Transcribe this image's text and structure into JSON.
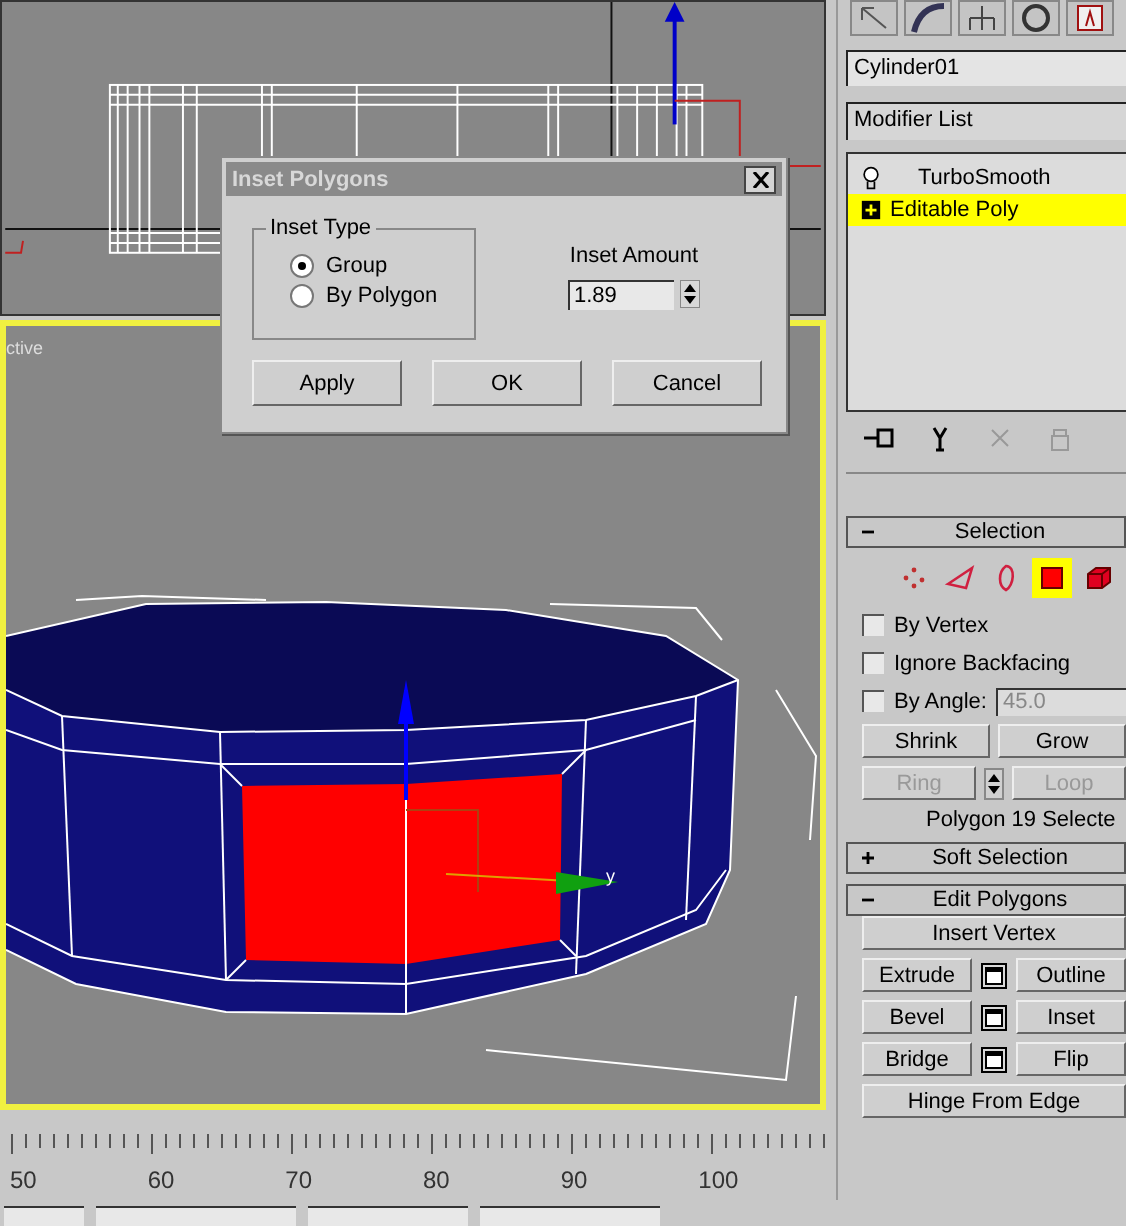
{
  "viewports": [
    {
      "kind": "front",
      "active": false
    },
    {
      "kind": "perspective",
      "label": "ctive",
      "active": true,
      "axis_label": "y"
    }
  ],
  "dialog": {
    "title": "Inset Polygons",
    "group_label": "Inset Type",
    "options": [
      {
        "label": "Group",
        "selected": true
      },
      {
        "label": "By Polygon",
        "selected": false
      }
    ],
    "amount_label": "Inset Amount",
    "amount_value": "1.89",
    "buttons": [
      "Apply",
      "OK",
      "Cancel"
    ]
  },
  "command_panel": {
    "object_name": "Cylinder01",
    "modifier_list": "Modifier List",
    "stack": [
      {
        "label": "TurboSmooth",
        "kind": "modifier",
        "selected": false
      },
      {
        "label": "Editable Poly",
        "kind": "base",
        "selected": true
      }
    ],
    "subobject_levels": [
      {
        "kind": "vertex",
        "selected": false
      },
      {
        "kind": "edge",
        "selected": false
      },
      {
        "kind": "border",
        "selected": false
      },
      {
        "kind": "polygon",
        "selected": true
      },
      {
        "kind": "element",
        "selected": false
      }
    ],
    "rollouts": [
      {
        "kind": "selection",
        "title": "Selection",
        "expanded": true,
        "checkboxes": [
          {
            "label": "By Vertex",
            "checked": false
          },
          {
            "label": "Ignore Backfacing",
            "checked": false
          },
          {
            "label": "By Angle:",
            "checked": false
          }
        ],
        "angle_value": "45.0",
        "button_rows": [
          {
            "kind": "plain",
            "buttons": [
              {
                "label": "Shrink",
                "disabled": false
              },
              {
                "label": "Grow",
                "disabled": false
              }
            ]
          },
          {
            "kind": "spinner",
            "buttons": [
              {
                "label": "Ring",
                "disabled": true
              },
              {
                "label": "Loop",
                "disabled": true
              }
            ]
          }
        ],
        "status": "Polygon 19 Selecte"
      },
      {
        "kind": "collapsed",
        "title": "Soft Selection",
        "expanded": false
      },
      {
        "kind": "edit",
        "title": "Edit Polygons",
        "expanded": true,
        "button_rows": [
          [
            "Insert Vertex"
          ],
          [
            "Extrude",
            "Outline"
          ],
          [
            "Bevel",
            "Inset"
          ],
          [
            "Bridge",
            "Flip"
          ],
          [
            "Hinge From Edge"
          ]
        ]
      }
    ]
  },
  "timeline": {
    "labels": [
      "50",
      "60",
      "70",
      "80",
      "90",
      "100"
    ]
  }
}
